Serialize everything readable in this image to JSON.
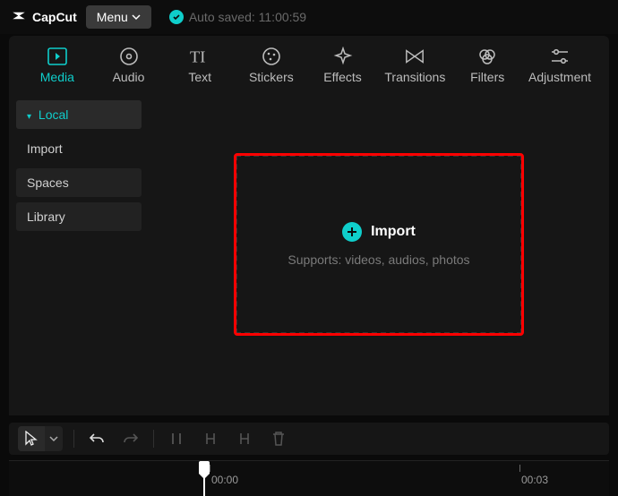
{
  "titlebar": {
    "app_name": "CapCut",
    "menu_label": "Menu",
    "autosave": "Auto saved: 11:00:59"
  },
  "tabs": {
    "media": "Media",
    "audio": "Audio",
    "text": "Text",
    "stickers": "Stickers",
    "effects": "Effects",
    "transitions": "Transitions",
    "filters": "Filters",
    "adjustment": "Adjustment"
  },
  "sidebar": {
    "local": "Local",
    "import": "Import",
    "spaces": "Spaces",
    "library": "Library"
  },
  "dropzone": {
    "import_label": "Import",
    "supports": "Supports: videos, audios, photos"
  },
  "timeline": {
    "t0": "00:00",
    "t1": "00:03"
  },
  "colors": {
    "accent": "#0fcecb",
    "highlight_box": "#ff0000"
  }
}
